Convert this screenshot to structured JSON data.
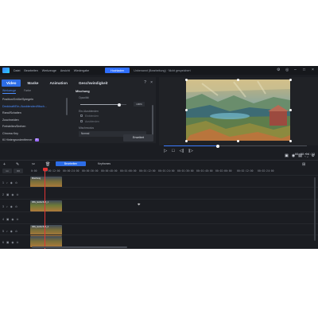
{
  "titlebar": {
    "menu": [
      "Datei",
      "Bearbeiten",
      "Werkzeuge",
      "Ansicht",
      "Wiedergabe"
    ],
    "upload_label": "Hochladen",
    "project_title": "Unbenannt (Bearbeitung) · Nicht gespeichert"
  },
  "panel": {
    "tabs": [
      "Video",
      "Maske",
      "Animation",
      "Geschwindigkeit"
    ],
    "sub_tabs": [
      "Werkzeuge",
      "Farbe"
    ],
    "features": [
      "Position/Größe/Spiegeln",
      "Deckkraft/Ein-/Ausblenden/Misch...",
      "Rand/Schatten",
      "Zuschneiden",
      "Freistellen/Drehen",
      "Chroma Key",
      "KI Hintergrundentferner"
    ],
    "ai_badge": "KI",
    "settings_title": "Mischung",
    "opacity_label": "Opazität",
    "opacity_value": "100%",
    "opacity_level": 0.85,
    "fade_label": "Ein-/Ausblenden",
    "fade_in_label": "Einblenden",
    "fade_out_label": "Ausblenden",
    "blend_label": "Mischmodus",
    "blend_value": "Normal",
    "advanced_label": "Erweitert"
  },
  "preview": {
    "timecode": "00:00:04:13",
    "progress": 0.38
  },
  "timeline": {
    "tab_active": "Bearbeiten",
    "tab_other": "Keyframes",
    "tick_labels": [
      "0:00",
      "00:00:12:00",
      "00:00:24:00",
      "00:00:36:00",
      "00:00:48:00",
      "00:01:00:00",
      "00:01:12:00",
      "00:01:24:00",
      "00:01:36:00",
      "00:01:48:00",
      "00:02:00:00",
      "00:02:12:00",
      "00:02:24:00"
    ],
    "tracks": [
      {
        "index": "1",
        "clip_label": "Mischung",
        "clip_start": 38,
        "clip_len": 40
      },
      {
        "index": "2",
        "clip_label": "",
        "clip_start": 0,
        "clip_len": 0
      },
      {
        "index": "3",
        "clip_label": "IMG_landschaft_1",
        "clip_start": 38,
        "clip_len": 40
      },
      {
        "index": "4",
        "clip_label": "",
        "clip_start": 0,
        "clip_len": 0
      },
      {
        "index": "5",
        "clip_label": "IMG_landschaft_2",
        "clip_start": 38,
        "clip_len": 40
      },
      {
        "index": "6",
        "clip_label": "",
        "clip_start": 38,
        "clip_len": 40
      }
    ]
  },
  "colors": {
    "accent": "#2d6de6",
    "playhead": "#e03434",
    "clip_green": "#6d7a3a"
  }
}
